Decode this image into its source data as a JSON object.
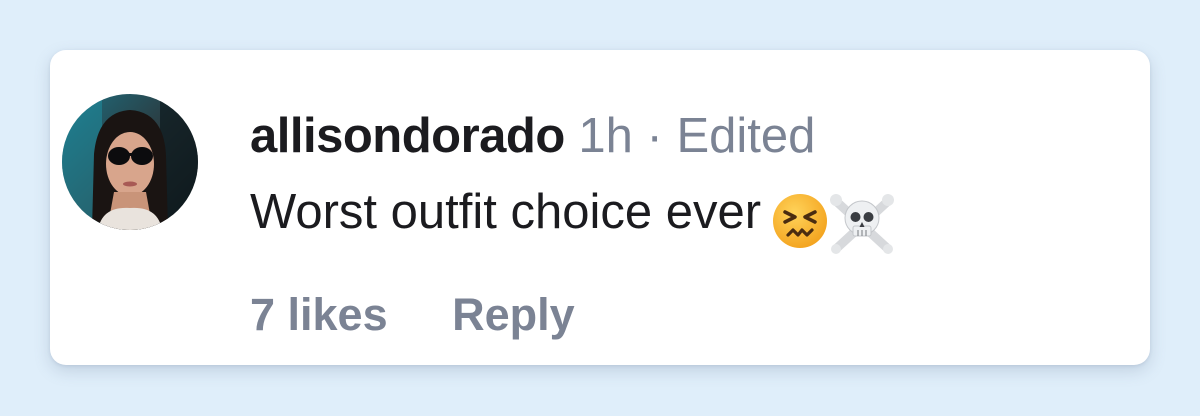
{
  "comment": {
    "username": "allisondorado",
    "time": "1h",
    "separator": "·",
    "edited": "Edited",
    "text": "Worst outfit choice ever",
    "emojis": [
      "confounded-face-emoji",
      "skull-and-crossbones-emoji"
    ],
    "likes": "7 likes",
    "reply": "Reply"
  },
  "colors": {
    "background": "#dfeefa",
    "card": "#ffffff",
    "text": "#1b1b1f",
    "muted": "#7b8394"
  }
}
